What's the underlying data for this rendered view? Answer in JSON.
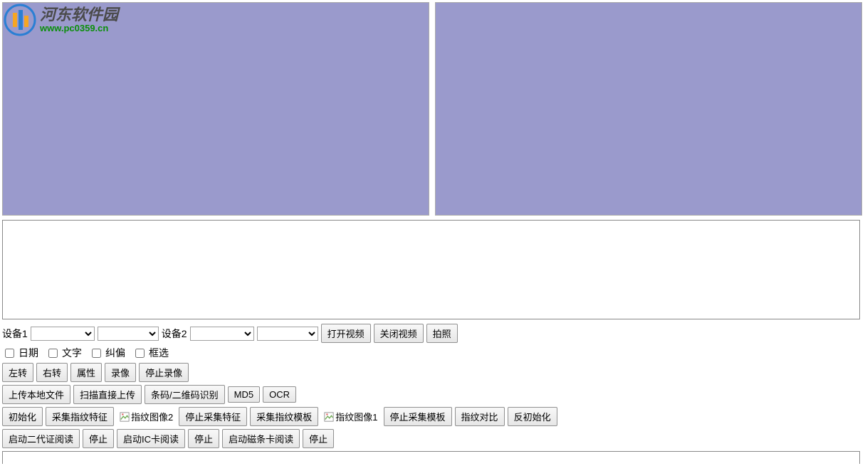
{
  "watermark": {
    "title": "河东软件园",
    "url": "www.pc0359.cn"
  },
  "device_row": {
    "label1": "设备1",
    "label2": "设备2",
    "btn_open": "打开视频",
    "btn_close": "关闭视频",
    "btn_capture": "拍照"
  },
  "checkboxes": {
    "date": "日期",
    "text": "文字",
    "deskew": "纠偏",
    "select": "框选"
  },
  "rotate_row": {
    "left": "左转",
    "right": "右转",
    "attr": "属性",
    "record": "录像",
    "stop_record": "停止录像"
  },
  "upload_row": {
    "upload_local": "上传本地文件",
    "scan_upload": "扫描直接上传",
    "barcode": "条码/二维码识别",
    "md5": "MD5",
    "ocr": "OCR"
  },
  "finger_row": {
    "init": "初始化",
    "collect_feature": "采集指纹特征",
    "img2_alt": "指纹图像2",
    "stop_feature": "停止采集特征",
    "collect_template": "采集指纹模板",
    "img1_alt": "指纹图像1",
    "stop_template": "停止采集模板",
    "compare": "指纹对比",
    "deinit": "反初始化"
  },
  "reader_row": {
    "id_read": "启动二代证阅读",
    "stop1": "停止",
    "ic_read": "启动IC卡阅读",
    "stop2": "停止",
    "mag_read": "启动磁条卡阅读",
    "stop3": "停止"
  }
}
